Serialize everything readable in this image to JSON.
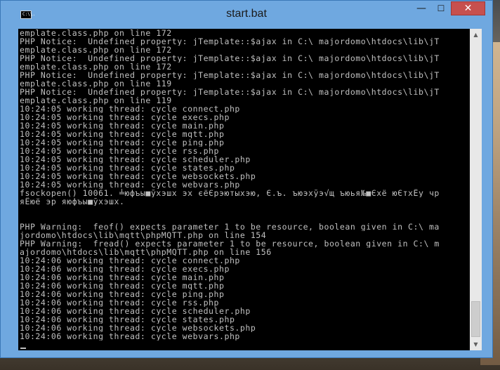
{
  "window": {
    "title": "start.bat",
    "icon": "console-window-icon",
    "icon_text": "C:\\\\.",
    "buttons": {
      "minimize": "—",
      "maximize": "☐",
      "close": "✕"
    }
  },
  "console": {
    "text_color": "#c0c0c0",
    "background": "#000000",
    "lines": [
      "emplate.class.php on line 172",
      "PHP Notice:  Undefined property: jTemplate::$ajax in C:\\_majordomo\\htdocs\\lib\\jT",
      "emplate.class.php on line 172",
      "PHP Notice:  Undefined property: jTemplate::$ajax in C:\\_majordomo\\htdocs\\lib\\jT",
      "emplate.class.php on line 172",
      "PHP Notice:  Undefined property: jTemplate::$ajax in C:\\_majordomo\\htdocs\\lib\\jT",
      "emplate.class.php on line 119",
      "PHP Notice:  Undefined property: jTemplate::$ajax in C:\\_majordomo\\htdocs\\lib\\jT",
      "emplate.class.php on line 119",
      "10:24:05 working thread: cycle_connect.php",
      "10:24:05 working thread: cycle_execs.php",
      "10:24:05 working thread: cycle_main.php",
      "10:24:05 working thread: cycle_mqtt.php",
      "10:24:05 working thread: cycle_ping.php",
      "10:24:05 working thread: cycle_rss.php",
      "10:24:05 working thread: cycle_scheduler.php",
      "10:24:05 working thread: cycle_states.php",
      "10:24:05 working thread: cycle_websockets.php",
      "10:24:05 working thread: cycle_webvars.php",
      "fsockopen() 10061. ╧юфъы■ўхэшх эх єёЄрэютыхэю, Є.ъ. ъюэхўэ√щ ъюья№■Єхё юЄтхЁу чр",
      "яЁюё эр яюфъы■ўхэшх.",
      "",
      "",
      "PHP Warning:  feof() expects parameter 1 to be resource, boolean given in C:\\_ma",
      "jordomo\\htdocs\\lib\\mqtt\\phpMQTT.php on line 154",
      "PHP Warning:  fread() expects parameter 1 to be resource, boolean given in C:\\_m",
      "ajordomo\\htdocs\\lib\\mqtt\\phpMQTT.php on line 156",
      "10:24:06 working thread: cycle_connect.php",
      "10:24:06 working thread: cycle_execs.php",
      "10:24:06 working thread: cycle_main.php",
      "10:24:06 working thread: cycle_mqtt.php",
      "10:24:06 working thread: cycle_ping.php",
      "10:24:06 working thread: cycle_rss.php",
      "10:24:06 working thread: cycle_scheduler.php",
      "10:24:06 working thread: cycle_states.php",
      "10:24:06 working thread: cycle_websockets.php",
      "10:24:06 working thread: cycle_webvars.php"
    ]
  },
  "scrollbar": {
    "up_arrow": "▲",
    "down_arrow": "▼",
    "position": 0.93
  }
}
